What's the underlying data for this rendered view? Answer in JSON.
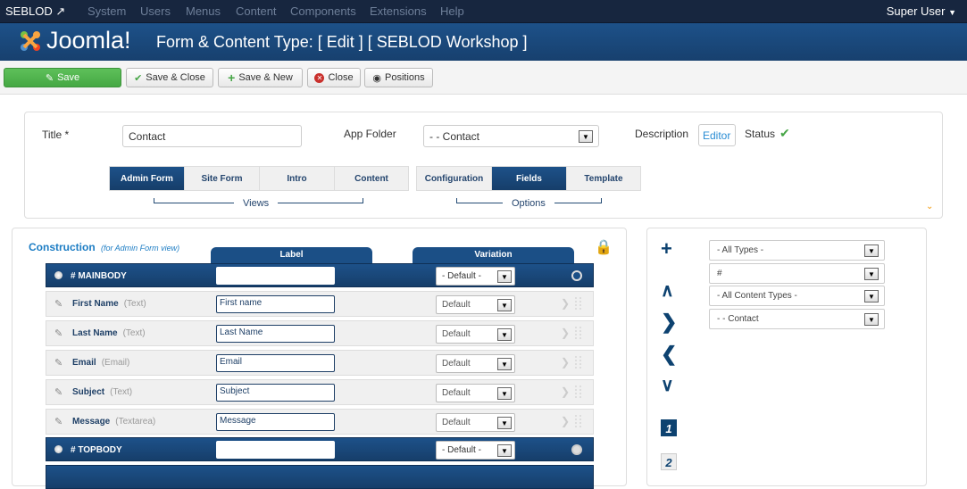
{
  "topnav": {
    "brand": "SEBLOD",
    "menu": [
      "System",
      "Users",
      "Menus",
      "Content",
      "Components",
      "Extensions",
      "Help"
    ],
    "user": "Super User"
  },
  "header": {
    "logo": "Joomla!",
    "title": "Form & Content Type: [ Edit ] [ SEBLOD Workshop ]"
  },
  "toolbar": {
    "save": "Save",
    "save_close": "Save & Close",
    "save_new": "Save & New",
    "close": "Close",
    "positions": "Positions"
  },
  "form": {
    "title_label": "Title *",
    "title_value": "Contact",
    "app_folder_label": "App Folder",
    "app_folder_value": "- - Contact",
    "description_label": "Description",
    "editor_button": "Editor",
    "status_label": "Status"
  },
  "views": {
    "caption": "Views",
    "tabs": [
      "Admin Form",
      "Site Form",
      "Intro",
      "Content"
    ]
  },
  "options": {
    "caption": "Options",
    "tabs": [
      "Configuration",
      "Fields",
      "Template"
    ]
  },
  "construction": {
    "title": "Construction",
    "subtitle": "(for Admin Form view)",
    "col_label": "Label",
    "col_variation": "Variation",
    "rows": [
      {
        "name": "# MAINBODY",
        "label": "",
        "variation": "- Default -"
      },
      {
        "name": "First Name",
        "type": "(Text)",
        "label": "First name",
        "variation": "Default"
      },
      {
        "name": "Last Name",
        "type": "(Text)",
        "label": "Last Name",
        "variation": "Default"
      },
      {
        "name": "Email",
        "type": "(Email)",
        "label": "Email",
        "variation": "Default"
      },
      {
        "name": "Subject",
        "type": "(Text)",
        "label": "Subject",
        "variation": "Default"
      },
      {
        "name": "Message",
        "type": "(Textarea)",
        "label": "Message",
        "variation": "Default"
      },
      {
        "name": "# TOPBODY",
        "label": "",
        "variation": "- Default -"
      }
    ]
  },
  "filters": [
    "- All Types -",
    "#",
    "- All Content Types -",
    "- - Contact"
  ],
  "pages": [
    "1",
    "2"
  ]
}
